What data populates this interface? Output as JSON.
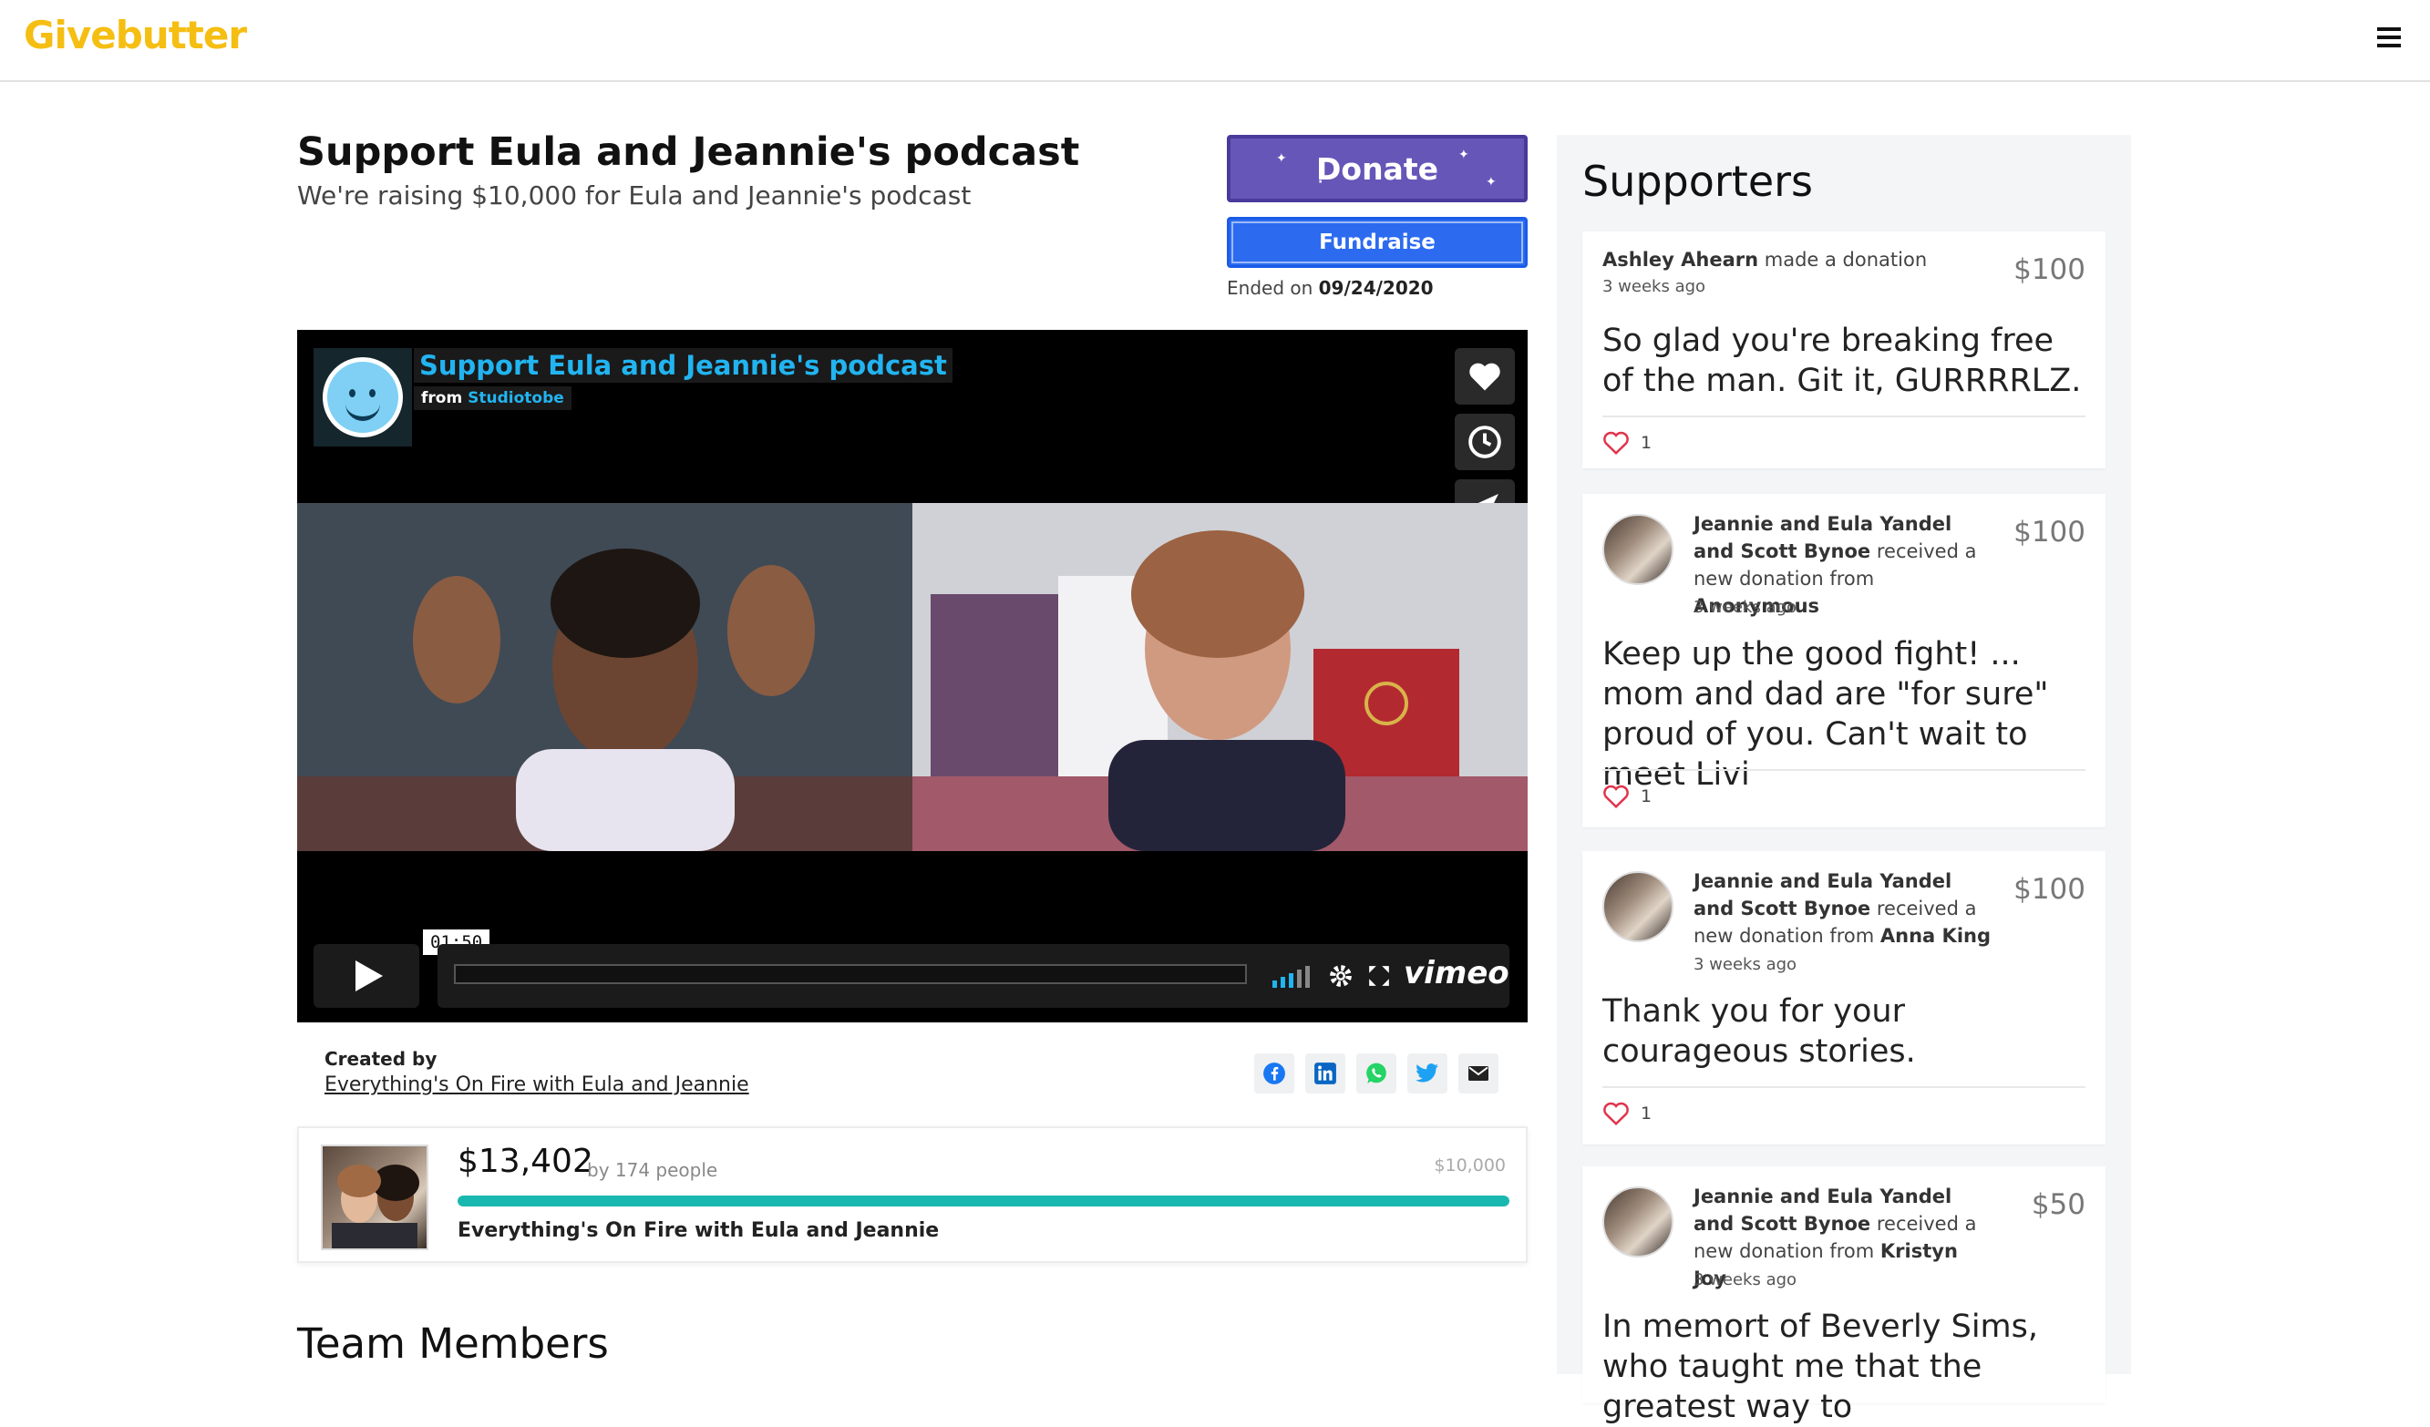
{
  "header": {
    "logo": "Givebutter"
  },
  "campaign": {
    "title": "Support Eula and Jeannie's podcast",
    "subtitle": "We're raising $10,000 for Eula and Jeannie's podcast",
    "donate_label": "Donate",
    "fundraise_label": "Fundraise",
    "ended_prefix": "Ended on",
    "ended_date": "09/24/2020"
  },
  "video": {
    "title": "Support Eula and Jeannie's podcast",
    "from_label": "from",
    "from_channel": "Studiotobe",
    "timestamp": "01:50",
    "brand": "vimeo"
  },
  "creator": {
    "label": "Created by",
    "name": "Everything's On Fire with Eula and Jeannie"
  },
  "progress": {
    "raised": "$13,402",
    "by_text": "by 174 people",
    "goal": "$10,000",
    "fraction": 1.0,
    "team_name": "Everything's On Fire with Eula and Jeannie"
  },
  "team": {
    "title": "Team Members"
  },
  "supporters": {
    "title": "Supporters",
    "items": [
      {
        "name": "Ashley Ahearn",
        "action": "made a donation",
        "ago": "3 weeks ago",
        "amount": "$100",
        "message": "So glad you're breaking free of the man. Git it, GURRRRLZ.",
        "likes": "1"
      },
      {
        "name": "Jeannie and Eula Yandel and Scott Bynoe",
        "action": "received a new donation from",
        "donor": "Anonymous",
        "ago": "3 weeks ago",
        "amount": "$100",
        "message": "Keep up the good fight! ... mom and dad are \"for sure\" proud of you. Can't wait to meet Livi",
        "likes": "1"
      },
      {
        "name": "Jeannie and Eula Yandel and Scott Bynoe",
        "action": "received a new donation from",
        "donor": "Anna King",
        "ago": "3 weeks ago",
        "amount": "$100",
        "message": "Thank you for your courageous stories.",
        "likes": "1"
      },
      {
        "name": "Jeannie and Eula Yandel and Scott Bynoe",
        "action": "received a new donation from",
        "donor": "Kristyn Joy",
        "ago": "3 weeks ago",
        "amount": "$50",
        "message": "In memort of Beverly Sims, who taught me that the greatest way to",
        "likes": ""
      }
    ]
  }
}
